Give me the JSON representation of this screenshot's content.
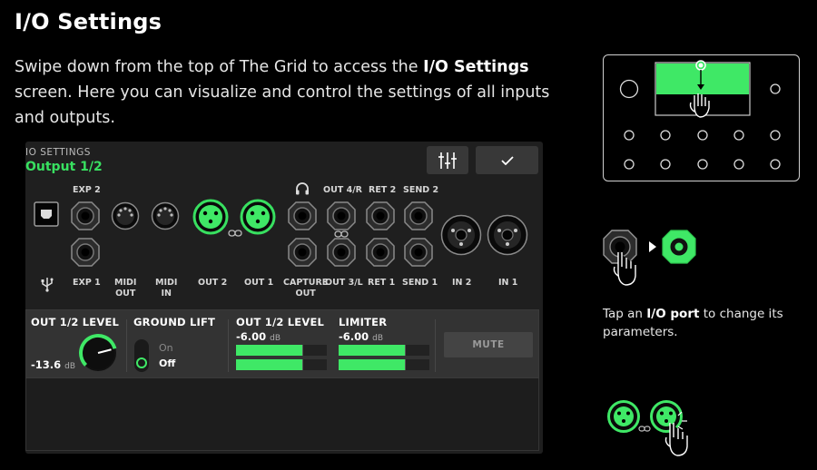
{
  "header": {
    "title": "I/O Settings",
    "intro_pre": "Swipe down from the top of The Grid to access the ",
    "intro_bold": "I/O Settings",
    "intro_post": " screen. Here you can visualize and control the settings of all inputs and outputs."
  },
  "device": {
    "section_label": "IO SETTINGS",
    "selected_title": "Output 1/2",
    "ports_top_labels": {
      "exp2": "EXP 2",
      "out4r": "OUT 4/R",
      "ret2": "RET 2",
      "send2": "SEND 2"
    },
    "ports_bottom_labels": {
      "exp1": "EXP 1",
      "midi_out_1": "MIDI",
      "midi_out_2": "OUT",
      "midi_in_1": "MIDI",
      "midi_in_2": "IN",
      "out2": "OUT 2",
      "out1": "OUT 1",
      "capture_1": "CAPTURE",
      "capture_2": "OUT",
      "out3l": "OUT 3/L",
      "ret1": "RET 1",
      "send1": "SEND 1",
      "in2": "IN 2",
      "in1": "IN 1"
    },
    "params": {
      "level_label": "OUT 1/2 LEVEL",
      "level_value": "-13.6",
      "level_unit": "dB",
      "level_knob_fraction": 0.78,
      "ground_lift_label": "GROUND LIFT",
      "ground_on": "On",
      "ground_off": "Off",
      "meter_label": "OUT 1/2 LEVEL",
      "meter_value": "-6.00",
      "meter_unit": "dB",
      "meter_fill_fraction": 0.73,
      "limiter_label": "LIMITER",
      "limiter_value": "-6.00",
      "limiter_unit": "dB",
      "limiter_fill_fraction": 0.73,
      "mute_label": "MUTE"
    },
    "colors": {
      "accent": "#38e060",
      "panel_bg": "#1f1f1f",
      "strip_bg": "#333333"
    }
  },
  "tip": {
    "pre": "Tap an ",
    "bold": "I/O port",
    "post": " to change its parameters."
  }
}
